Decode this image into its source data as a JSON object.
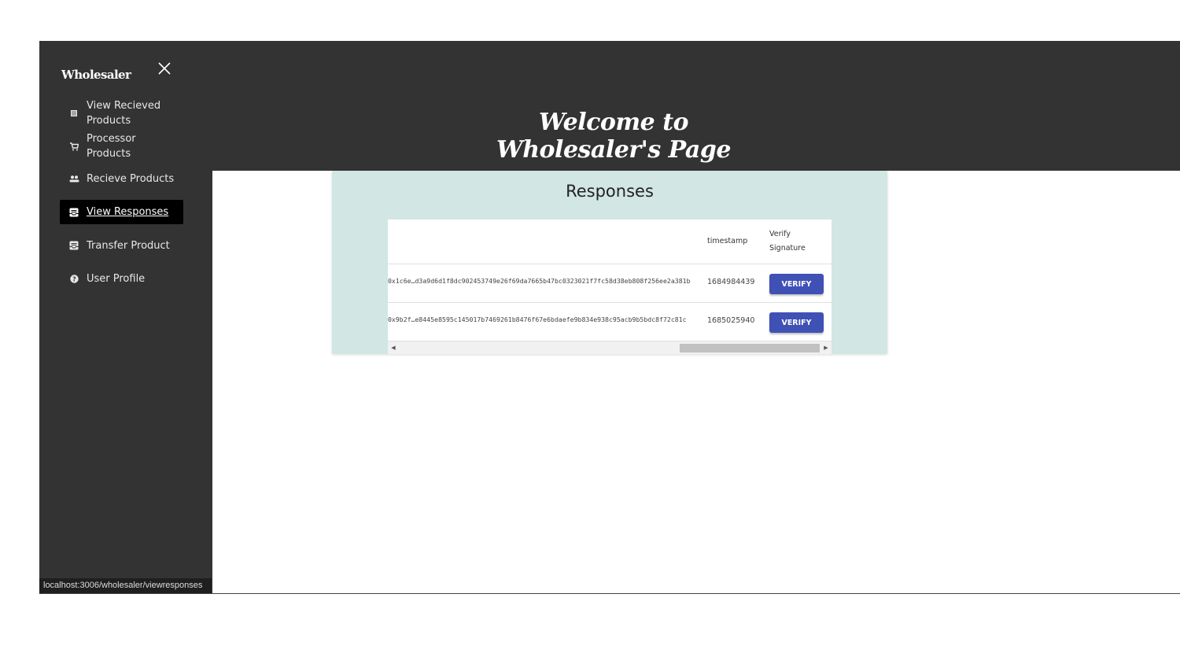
{
  "sidebar": {
    "brand": "Wholesaler",
    "close_icon": "close-icon",
    "items": [
      {
        "label_line1": "View Recieved",
        "label_line2": "Products",
        "icon": "list-icon"
      },
      {
        "label_line1": "Processor",
        "label_line2": "Products",
        "icon": "cart-icon"
      },
      {
        "label": "Recieve Products",
        "icon": "people-icon"
      },
      {
        "label": "View Responses",
        "icon": "inbox-icon",
        "active": true
      },
      {
        "label": "Transfer Product",
        "icon": "inbox-icon"
      },
      {
        "label": "User Profile",
        "icon": "help-icon"
      }
    ]
  },
  "header": {
    "welcome": "Welcome to Wholesaler's Page"
  },
  "responses": {
    "title": "Responses",
    "columns": {
      "timestamp": "timestamp",
      "verify_line1": "Verify",
      "verify_line2": "Signature"
    },
    "rows": [
      {
        "hash": "0x1c6e…d3a9d6d1f8dc902453749e26f69da7665b47bc0323021f7fc58d38eb808f256ee2a381b",
        "timestamp": "1684984439",
        "action": "VERIFY"
      },
      {
        "hash": "0x9b2f…e8445e8595c145017b7469261b8476f67e6bdaefe9b834e938c95acb9b5bdc8f72c81c",
        "timestamp": "1685025940",
        "action": "VERIFY"
      }
    ]
  },
  "status_bar": {
    "url": "localhost:3006/wholesaler/viewresponses"
  },
  "colors": {
    "dark_bg": "#333333",
    "card_bg": "#d2e6e4",
    "verify_button": "#3f51b5"
  }
}
